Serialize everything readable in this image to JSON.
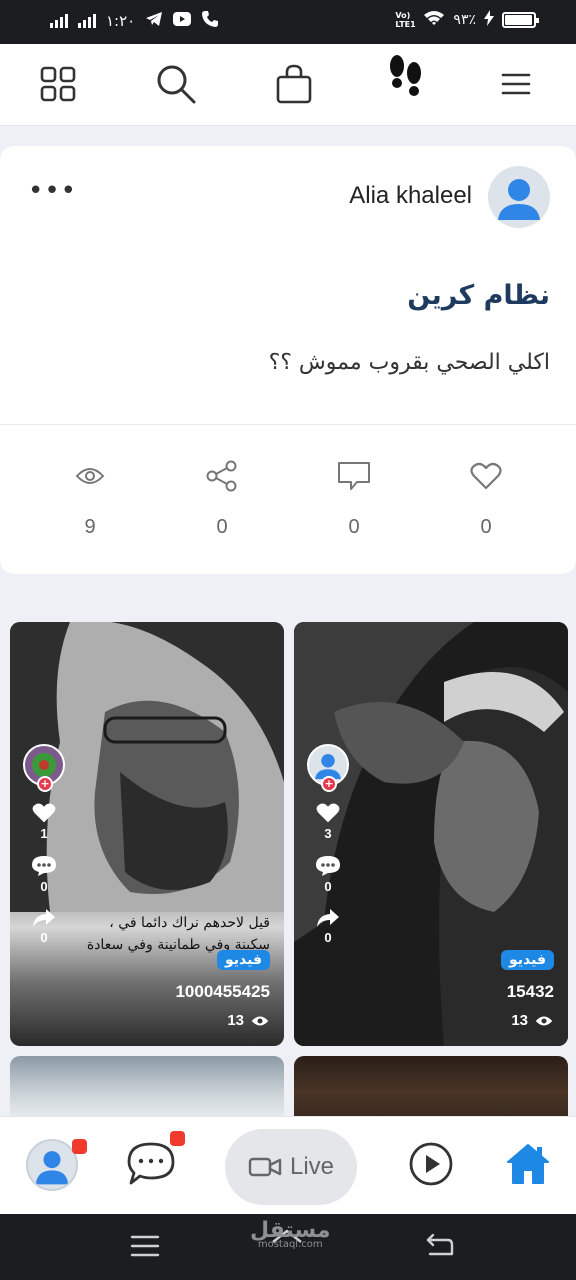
{
  "status_bar": {
    "time": "١:٢٠",
    "battery": "٩٣٪",
    "network_label": "Vo) LTE1"
  },
  "top_nav": {
    "items": [
      "grid-icon",
      "search-icon",
      "shopping-bag-icon",
      "footprints-icon",
      "menu-icon"
    ]
  },
  "post": {
    "author": "Alia khaleel",
    "title": "نظام كرين",
    "body": "اكلي الصحي بقروب مموش ؟؟",
    "stats": {
      "views": "9",
      "shares": "0",
      "comments": "0",
      "likes": "0"
    }
  },
  "videos": [
    {
      "likes": "1",
      "comments": "0",
      "shares": "0",
      "caption": "قيل لاحدهم نراك دائما في ، سكينة وفي طمانينة وفي سعادة",
      "badge": "فيديو",
      "id": "1000455425",
      "views": "13"
    },
    {
      "likes": "3",
      "comments": "0",
      "shares": "0",
      "caption": "",
      "badge": "فيديو",
      "id": "15432",
      "views": "13"
    }
  ],
  "bottom_nav": {
    "live_label": "Live",
    "items": [
      "profile-icon",
      "chat-icon",
      "live-camera-icon",
      "play-icon",
      "home-icon"
    ]
  },
  "watermark": {
    "text": "مستقل",
    "sub": "mostaql.com"
  },
  "colors": {
    "accent": "#1e88e5",
    "title": "#1f3a5f",
    "notification": "#f03a2e"
  }
}
